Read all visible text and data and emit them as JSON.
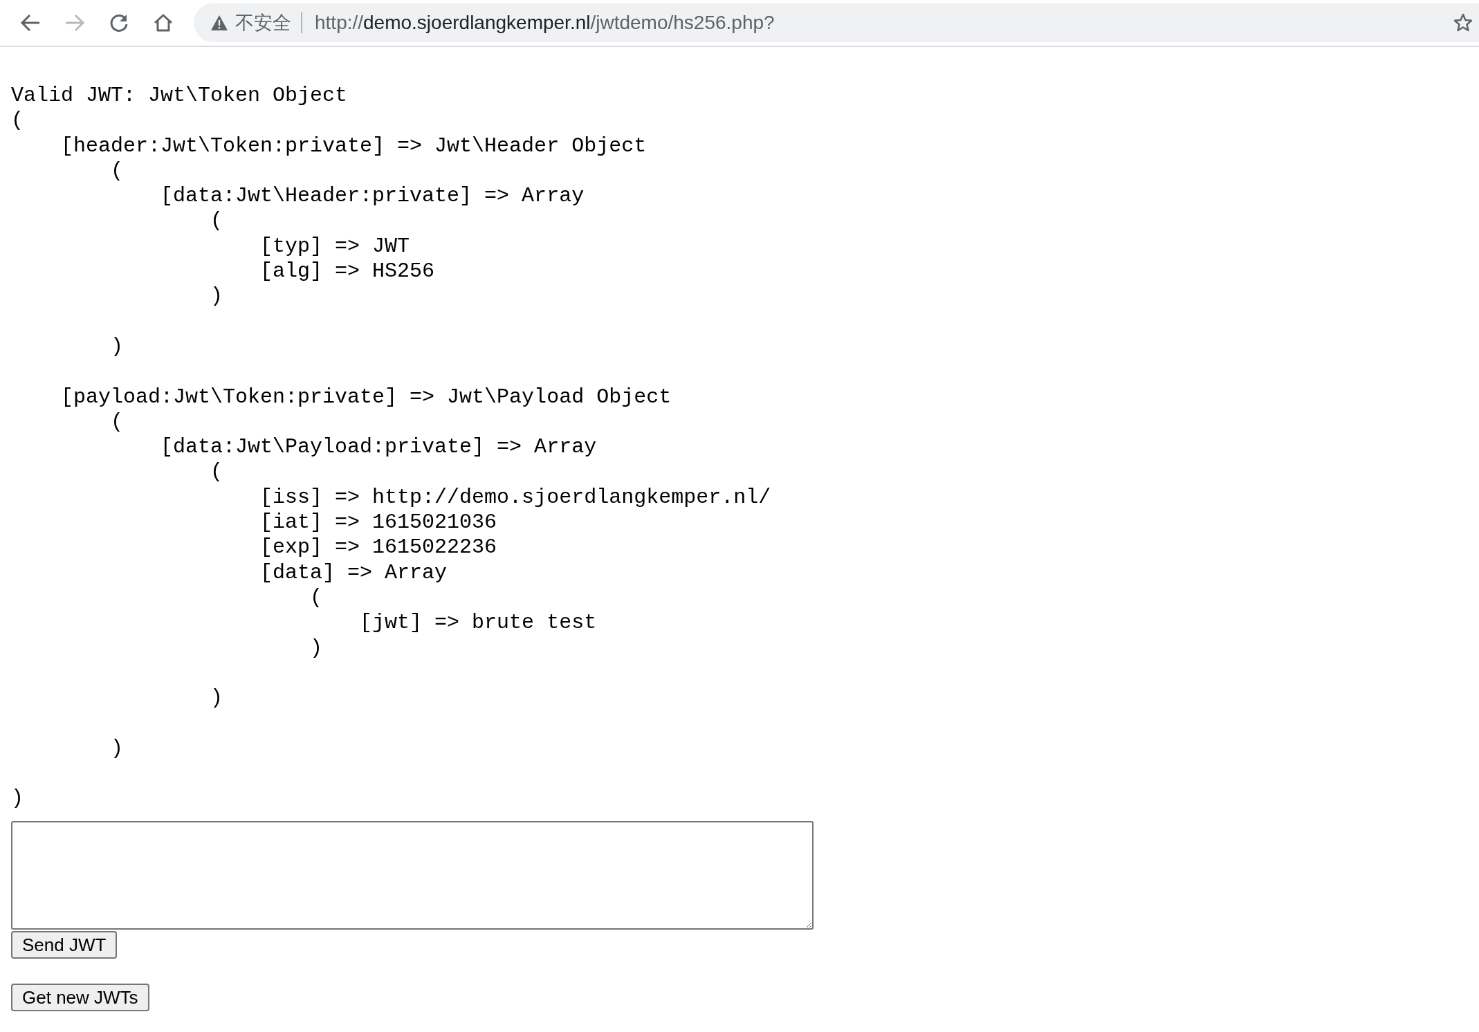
{
  "browser": {
    "security_label": "不安全",
    "url": {
      "scheme": "http://",
      "host": "demo.sjoerdlangkemper.nl",
      "path": "/jwtdemo/hs256.php?"
    },
    "forward_disabled": true
  },
  "output": "Valid JWT: Jwt\\Token Object\n(\n    [header:Jwt\\Token:private] => Jwt\\Header Object\n        (\n            [data:Jwt\\Header:private] => Array\n                (\n                    [typ] => JWT\n                    [alg] => HS256\n                )\n\n        )\n\n    [payload:Jwt\\Token:private] => Jwt\\Payload Object\n        (\n            [data:Jwt\\Payload:private] => Array\n                (\n                    [iss] => http://demo.sjoerdlangkemper.nl/\n                    [iat] => 1615021036\n                    [exp] => 1615022236\n                    [data] => Array\n                        (\n                            [jwt] => brute test\n                        )\n\n                )\n\n        )\n\n)",
  "buttons": [
    "Send JWT",
    "Get new JWTs"
  ]
}
